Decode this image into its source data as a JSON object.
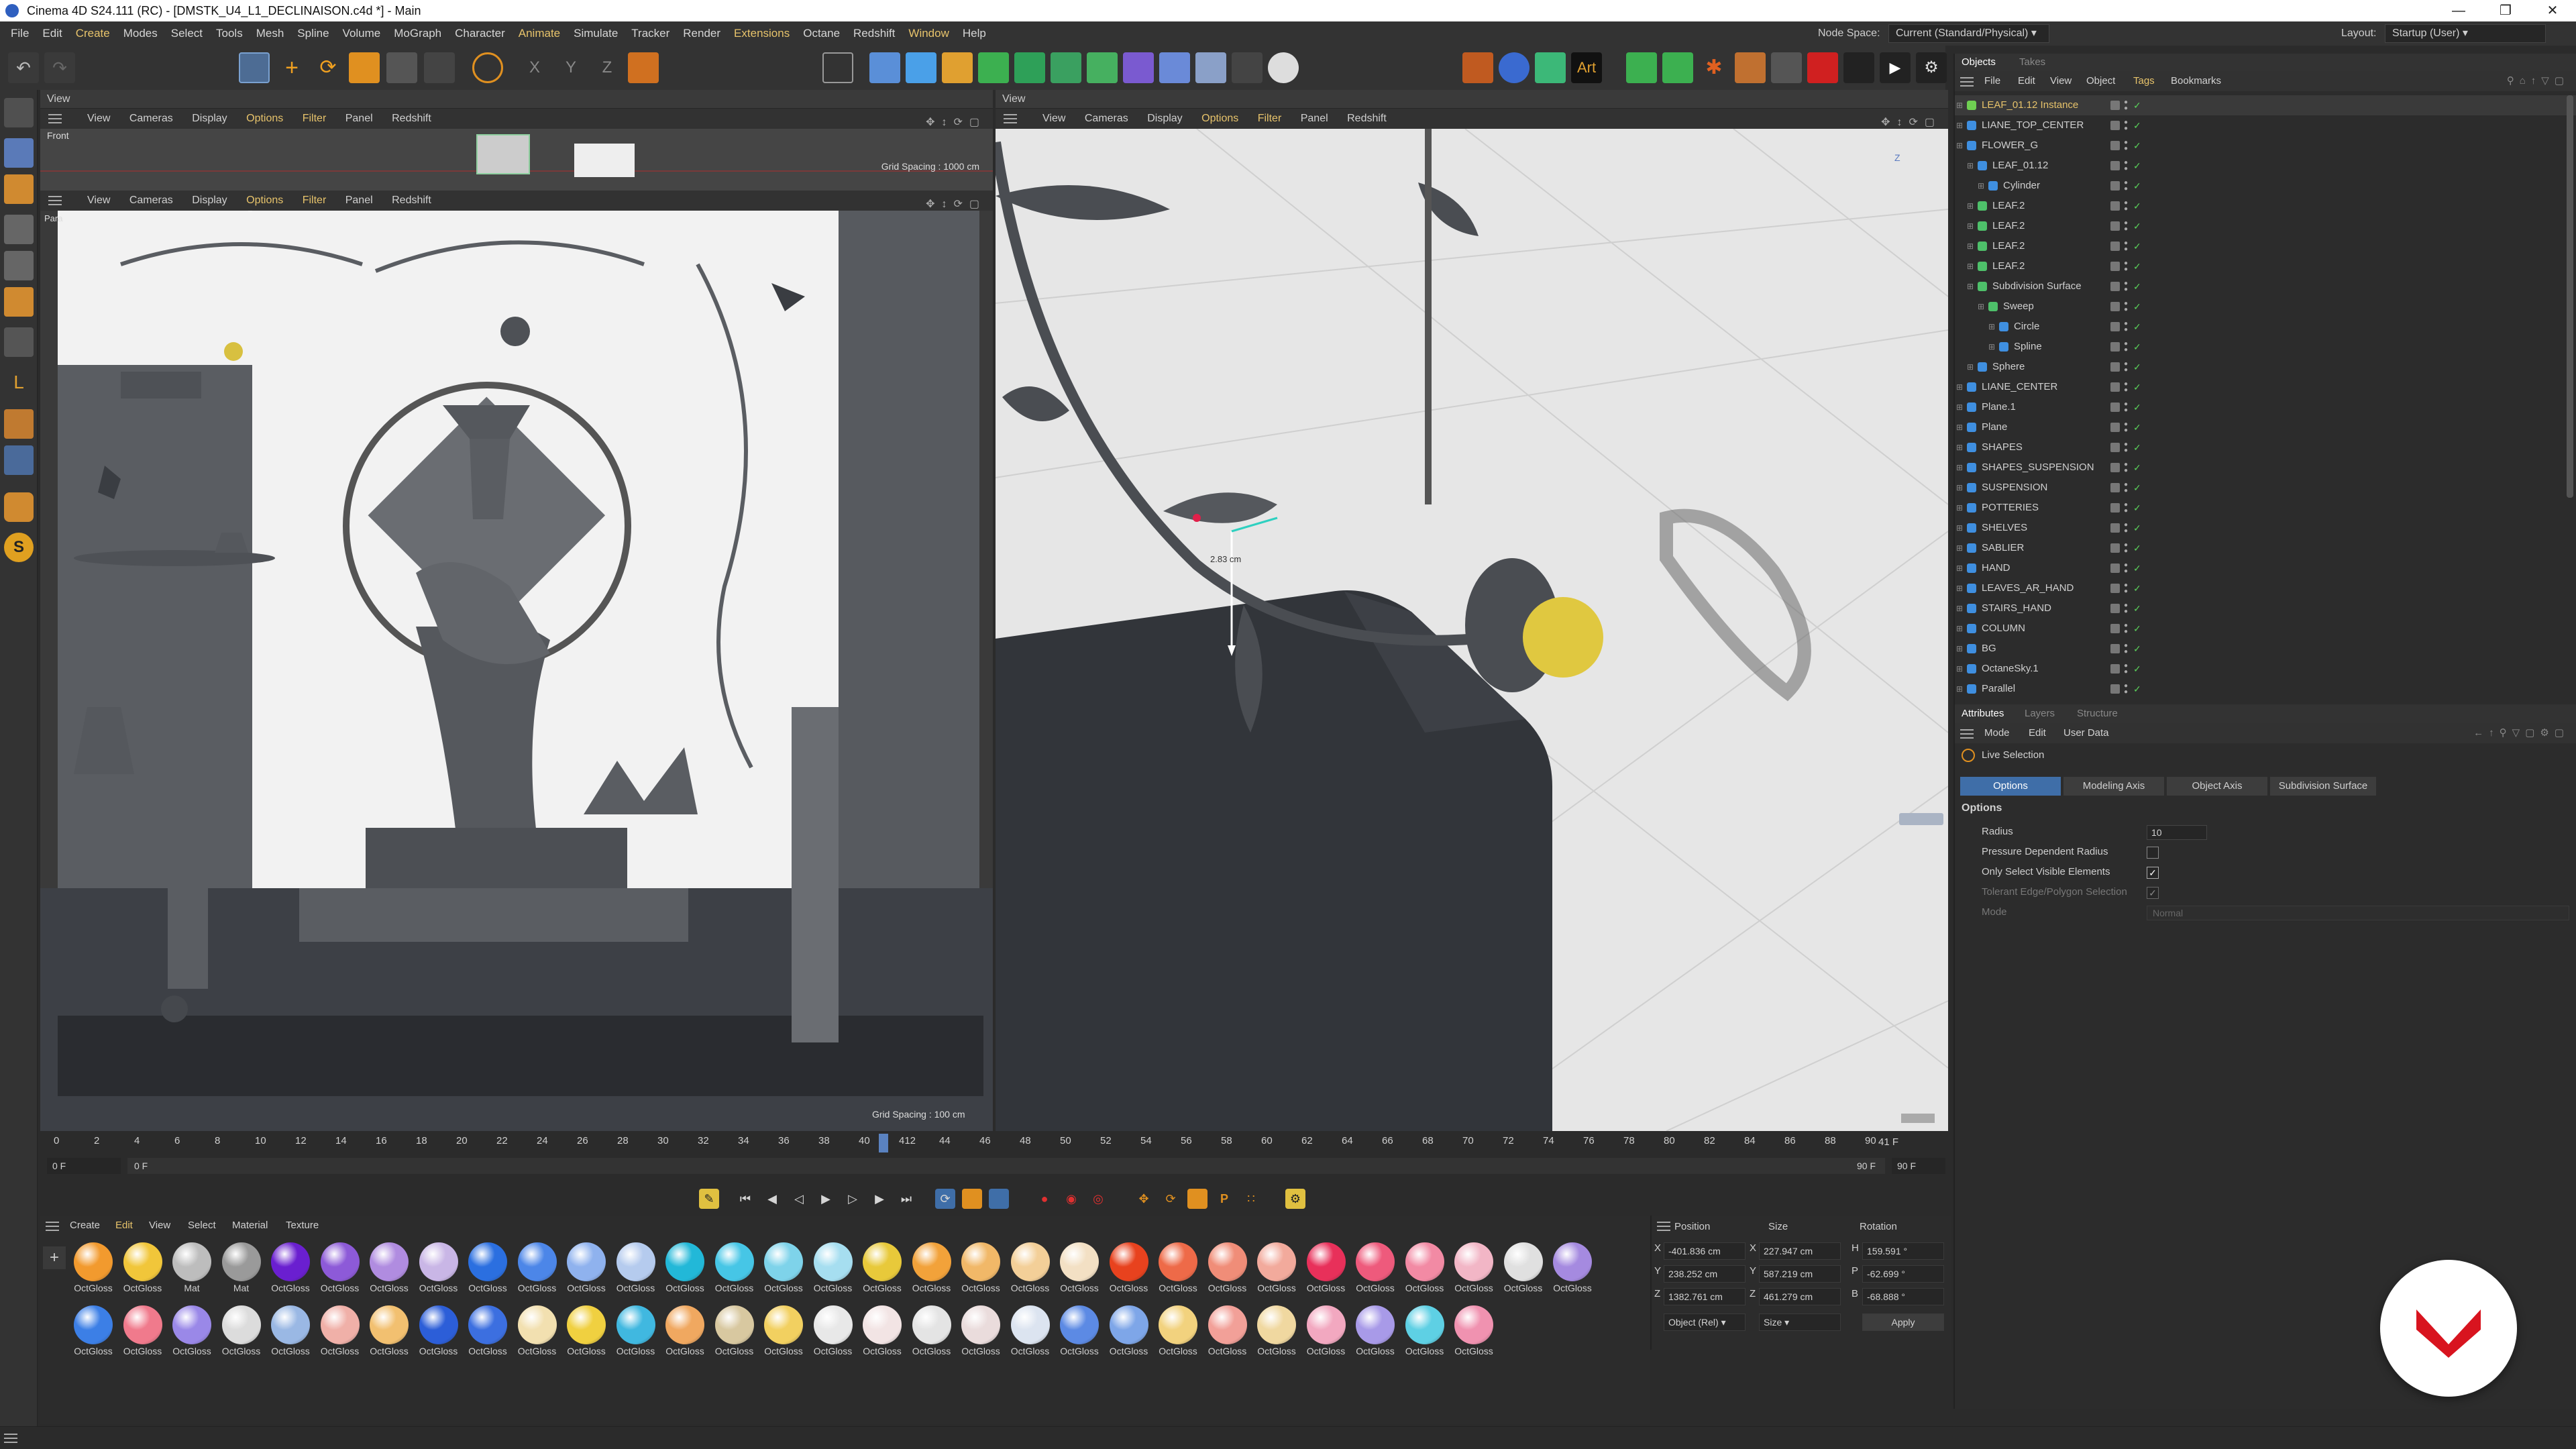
{
  "window": {
    "title": "Cinema 4D S24.111 (RC) - [DMSTK_U4_L1_DECLINAISON.c4d *] - Main",
    "controls": [
      "minimize-icon",
      "maximize-icon",
      "close-icon"
    ]
  },
  "menubar": {
    "items": [
      "File",
      "Edit",
      "Create",
      "Modes",
      "Select",
      "Tools",
      "Mesh",
      "Spline",
      "Volume",
      "MoGraph",
      "Character",
      "Animate",
      "Simulate",
      "Tracker",
      "Render",
      "Extensions",
      "Octane",
      "Redshift",
      "Window",
      "Help"
    ],
    "node_space_label": "Node Space:",
    "node_space_value": "Current (Standard/Physical)",
    "layout_label": "Layout:",
    "layout_value": "Startup (User)"
  },
  "viewports": {
    "top_left": {
      "panel_title": "View",
      "menu": [
        "View",
        "Cameras",
        "Display",
        "Options",
        "Filter",
        "Panel",
        "Redshift"
      ],
      "camera_name": "Front",
      "grid_spacing": "Grid Spacing : 1000 cm"
    },
    "bottom_left": {
      "menu": [
        "View",
        "Cameras",
        "Display",
        "Options",
        "Filter",
        "Panel",
        "Redshift"
      ],
      "camera_name": "Para",
      "grid_spacing": "Grid Spacing : 100 cm"
    },
    "right": {
      "panel_title": "View",
      "menu": [
        "View",
        "Cameras",
        "Display",
        "Options",
        "Filter",
        "Panel",
        "Redshift"
      ],
      "hud_value": "2.83 cm"
    }
  },
  "objects_panel": {
    "tabs": [
      "Objects",
      "Takes"
    ],
    "menu": [
      "File",
      "Edit",
      "View",
      "Object",
      "Tags",
      "Bookmarks"
    ],
    "items": [
      {
        "name": "LEAF_01.12 Instance",
        "indent": 0,
        "color": "#6fcf52",
        "highlight": true
      },
      {
        "name": "LIANE_TOP_CENTER",
        "indent": 0,
        "color": "#3f8fe0"
      },
      {
        "name": "FLOWER_G",
        "indent": 0,
        "color": "#3f8fe0"
      },
      {
        "name": "LEAF_01.12",
        "indent": 1,
        "color": "#3f8fe0"
      },
      {
        "name": "Cylinder",
        "indent": 2,
        "color": "#3f8fe0"
      },
      {
        "name": "LEAF.2",
        "indent": 1,
        "color": "#4ec06a"
      },
      {
        "name": "LEAF.2",
        "indent": 1,
        "color": "#4ec06a"
      },
      {
        "name": "LEAF.2",
        "indent": 1,
        "color": "#4ec06a"
      },
      {
        "name": "LEAF.2",
        "indent": 1,
        "color": "#4ec06a"
      },
      {
        "name": "Subdivision Surface",
        "indent": 1,
        "color": "#4ec06a"
      },
      {
        "name": "Sweep",
        "indent": 2,
        "color": "#4ec06a"
      },
      {
        "name": "Circle",
        "indent": 3,
        "color": "#3f8fe0"
      },
      {
        "name": "Spline",
        "indent": 3,
        "color": "#3f8fe0"
      },
      {
        "name": "Sphere",
        "indent": 1,
        "color": "#3f8fe0"
      },
      {
        "name": "LIANE_CENTER",
        "indent": 0,
        "color": "#3f8fe0"
      },
      {
        "name": "Plane.1",
        "indent": 0,
        "color": "#3f8fe0"
      },
      {
        "name": "Plane",
        "indent": 0,
        "color": "#3f8fe0"
      },
      {
        "name": "SHAPES",
        "indent": 0,
        "color": "#3f8fe0"
      },
      {
        "name": "SHAPES_SUSPENSION",
        "indent": 0,
        "color": "#3f8fe0"
      },
      {
        "name": "SUSPENSION",
        "indent": 0,
        "color": "#3f8fe0"
      },
      {
        "name": "POTTERIES",
        "indent": 0,
        "color": "#3f8fe0"
      },
      {
        "name": "SHELVES",
        "indent": 0,
        "color": "#3f8fe0"
      },
      {
        "name": "SABLIER",
        "indent": 0,
        "color": "#3f8fe0"
      },
      {
        "name": "HAND",
        "indent": 0,
        "color": "#3f8fe0"
      },
      {
        "name": "LEAVES_AR_HAND",
        "indent": 0,
        "color": "#3f8fe0"
      },
      {
        "name": "STAIRS_HAND",
        "indent": 0,
        "color": "#3f8fe0"
      },
      {
        "name": "COLUMN",
        "indent": 0,
        "color": "#3f8fe0"
      },
      {
        "name": "BG",
        "indent": 0,
        "color": "#3f8fe0"
      },
      {
        "name": "OctaneSky.1",
        "indent": 0,
        "color": "#3f8fe0"
      },
      {
        "name": "Parallel",
        "indent": 0,
        "color": "#3f8fe0"
      }
    ]
  },
  "attributes_panel": {
    "tabs": [
      "Attributes",
      "Layers",
      "Structure"
    ],
    "menu": [
      "Mode",
      "Edit",
      "User Data"
    ],
    "tool_name": "Live Selection",
    "sub_tabs": [
      "Options",
      "Modeling Axis",
      "Object Axis",
      "Subdivision Surface"
    ],
    "section": "Options",
    "radius_label": "Radius",
    "radius_value": "10",
    "pressure_label": "Pressure Dependent Radius",
    "only_visible_label": "Only Select Visible Elements",
    "tolerant_label": "Tolerant Edge/Polygon Selection",
    "mode_label": "Mode",
    "mode_value": "Normal"
  },
  "timeline": {
    "ticks": [
      "0",
      "2",
      "4",
      "6",
      "8",
      "10",
      "12",
      "14",
      "16",
      "18",
      "20",
      "22",
      "24",
      "26",
      "28",
      "30",
      "32",
      "34",
      "36",
      "38",
      "40",
      "412",
      "44",
      "46",
      "48",
      "50",
      "52",
      "54",
      "56",
      "58",
      "60",
      "62",
      "64",
      "66",
      "68",
      "70",
      "72",
      "74",
      "76",
      "78",
      "80",
      "82",
      "84",
      "86",
      "88",
      "90"
    ],
    "current_frame": "41 F",
    "start_field": "0 F",
    "min_field": "0 F",
    "max_field": "90 F",
    "end_field": "90 F"
  },
  "material_manager": {
    "menu": [
      "Create",
      "Edit",
      "View",
      "Select",
      "Material",
      "Texture"
    ],
    "row1": [
      {
        "label": "OctGloss",
        "color": "#f29a2e"
      },
      {
        "label": "OctGloss",
        "color": "#f1c63a"
      },
      {
        "label": "Mat",
        "color": "#bdbdbd"
      },
      {
        "label": "Mat",
        "color": "#9a9a9a"
      },
      {
        "label": "OctGloss",
        "color": "#6a1fd0"
      },
      {
        "label": "OctGloss",
        "color": "#8d5ad8"
      },
      {
        "label": "OctGloss",
        "color": "#b08ce0"
      },
      {
        "label": "OctGloss",
        "color": "#c9b6e6"
      },
      {
        "label": "OctGloss",
        "color": "#2b6fe0"
      },
      {
        "label": "OctGloss",
        "color": "#4c86e8"
      },
      {
        "label": "OctGloss",
        "color": "#8fb2ee"
      },
      {
        "label": "OctGloss",
        "color": "#b5cbee"
      },
      {
        "label": "OctGloss",
        "color": "#22b8d8"
      },
      {
        "label": "OctGloss",
        "color": "#46c6e6"
      },
      {
        "label": "OctGloss",
        "color": "#7ed3ea"
      },
      {
        "label": "OctGloss",
        "color": "#a6def0"
      },
      {
        "label": "OctGloss",
        "color": "#e8c93a"
      },
      {
        "label": "OctGloss",
        "color": "#f2a23a"
      },
      {
        "label": "OctGloss",
        "color": "#f1b868"
      },
      {
        "label": "OctGloss",
        "color": "#f3cf98"
      },
      {
        "label": "OctGloss",
        "color": "#f3e0c4"
      },
      {
        "label": "OctGloss",
        "color": "#e8421e"
      },
      {
        "label": "OctGloss",
        "color": "#ee6a48"
      },
      {
        "label": "OctGloss",
        "color": "#f08d78"
      },
      {
        "label": "OctGloss",
        "color": "#f2aa9c"
      },
      {
        "label": "OctGloss",
        "color": "#e8305a"
      },
      {
        "label": "OctGloss",
        "color": "#ee5a7c"
      },
      {
        "label": "OctGloss",
        "color": "#f28aa4"
      },
      {
        "label": "OctGloss",
        "color": "#f2b6c6"
      },
      {
        "label": "OctGloss",
        "color": "#e0e0e0"
      },
      {
        "label": "OctGloss",
        "color": "#a58ae0"
      }
    ],
    "row2": [
      {
        "label": "OctGloss",
        "color": "#3c7fe6"
      },
      {
        "label": "OctGloss",
        "color": "#f07a8c"
      },
      {
        "label": "OctGloss",
        "color": "#9a88e8"
      },
      {
        "label": "OctGloss",
        "color": "#dcdcdc"
      },
      {
        "label": "OctGloss",
        "color": "#9ab8e4"
      },
      {
        "label": "OctGloss",
        "color": "#f0b0a8"
      },
      {
        "label": "OctGloss",
        "color": "#f2c070"
      },
      {
        "label": "OctGloss",
        "color": "#2c5ed8"
      },
      {
        "label": "OctGloss",
        "color": "#3c6fe0"
      },
      {
        "label": "OctGloss",
        "color": "#f2e0b0"
      },
      {
        "label": "OctGloss",
        "color": "#f0d040"
      },
      {
        "label": "OctGloss",
        "color": "#40b8e0"
      },
      {
        "label": "OctGloss",
        "color": "#f0a860"
      },
      {
        "label": "OctGloss",
        "color": "#d8c8a0"
      },
      {
        "label": "OctGloss",
        "color": "#f2d060"
      },
      {
        "label": "OctGloss",
        "color": "#e8e8e8"
      },
      {
        "label": "OctGloss",
        "color": "#f2e4e4"
      },
      {
        "label": "OctGloss",
        "color": "#e4e4e4"
      },
      {
        "label": "OctGloss",
        "color": "#eadcdc"
      },
      {
        "label": "OctGloss",
        "color": "#dce4f0"
      },
      {
        "label": "OctGloss",
        "color": "#5c8ae4"
      },
      {
        "label": "OctGloss",
        "color": "#7ea6e8"
      },
      {
        "label": "OctGloss",
        "color": "#f2d27e"
      },
      {
        "label": "OctGloss",
        "color": "#f2a098"
      },
      {
        "label": "OctGloss",
        "color": "#f0d8a0"
      },
      {
        "label": "OctGloss",
        "color": "#f2a8c0"
      },
      {
        "label": "OctGloss",
        "color": "#a89ae8"
      },
      {
        "label": "OctGloss",
        "color": "#5ed0e4"
      },
      {
        "label": "OctGloss",
        "color": "#f092b0"
      }
    ]
  },
  "coordinates": {
    "headers": [
      "Position",
      "Size",
      "Rotation"
    ],
    "rows": [
      {
        "axis": "X",
        "position": "-401.836 cm",
        "size_axis": "X",
        "size": "227.947 cm",
        "rot_axis": "H",
        "rotation": "159.591 °"
      },
      {
        "axis": "Y",
        "position": "238.252 cm",
        "size_axis": "Y",
        "size": "587.219 cm",
        "rot_axis": "P",
        "rotation": "-62.699 °"
      },
      {
        "axis": "Z",
        "position": "1382.761 cm",
        "size_axis": "Z",
        "size": "461.279 cm",
        "rot_axis": "B",
        "rotation": "-68.888 °"
      }
    ],
    "mode_dropdown": "Object (Rel)",
    "size_dropdown": "Size",
    "apply_label": "Apply"
  },
  "colors": {
    "accent_blue": "#3f6ea8",
    "highlight_yellow": "#e7c36b",
    "logo_red": "#d8141f"
  }
}
